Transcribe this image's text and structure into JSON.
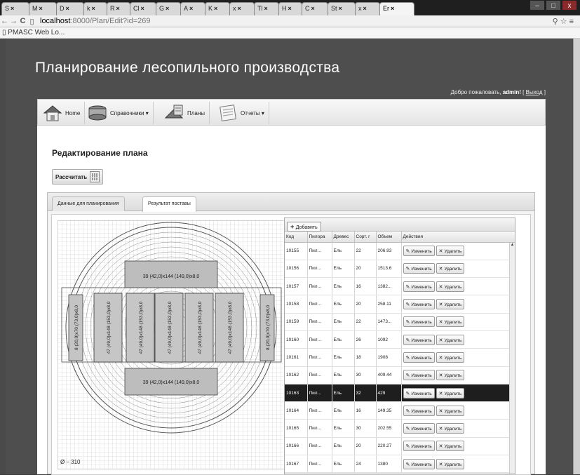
{
  "browser": {
    "tabs": [
      {
        "label": "S"
      },
      {
        "label": "M"
      },
      {
        "label": "D"
      },
      {
        "label": "k"
      },
      {
        "label": "R"
      },
      {
        "label": "Cl"
      },
      {
        "label": "G"
      },
      {
        "label": "A"
      },
      {
        "label": "K"
      },
      {
        "label": "x"
      },
      {
        "label": "Tl"
      },
      {
        "label": "H"
      },
      {
        "label": "C"
      },
      {
        "label": "St"
      },
      {
        "label": "x"
      },
      {
        "label": "Er",
        "active": true
      }
    ],
    "back": "←",
    "forward": "→",
    "reload": "C",
    "url_host": "localhost",
    "url_path": ":8000/Plan/Edit?id=269",
    "bookmark": "PMASC Web Lo..."
  },
  "site": {
    "title": "Планирование лесопильного производства",
    "welcome_prefix": "Добро пожаловать,",
    "user": "admin!",
    "logout": "Выход"
  },
  "menu": {
    "items": [
      {
        "label": "Home",
        "icon": "home-icon"
      },
      {
        "label": "Справочники ▾",
        "icon": "database-icon"
      },
      {
        "label": "Планы",
        "icon": "plans-icon"
      },
      {
        "label": "Отчеты ▾",
        "icon": "reports-icon"
      }
    ]
  },
  "page": {
    "heading": "Редактирование плана",
    "calc_button": "Рассчитать"
  },
  "panel_tabs": {
    "tab1": "Данные для планирования",
    "tab2": "Результат поставы"
  },
  "drawing": {
    "top_label": "39 (42,0)х144 (149,0)х8,0",
    "bottom_label": "39 (42,0)х144 (149,0)х8,0",
    "left_label": "8 (20,0)х70 (73,0)х8,0",
    "right_label": "8 (20,0)х70 (73,0)х8,0",
    "center_labels": [
      "47 (49,0)х148 (153,0)х8,0",
      "47 (49,0)х148 (153,0)х8,0",
      "47 (49,0)х148 (153,0)х8,0",
      "47 (49,0)х148 (153,0)х8,0",
      "47 (49,0)х148 (153,0)х8,0"
    ],
    "diameter": "Ø – 310"
  },
  "grid": {
    "add_label": "Добавить",
    "columns": [
      "Код",
      "Пилора",
      "Древес",
      "Сорт. г",
      "Объем",
      "Действия"
    ],
    "edit_label": "Изменить",
    "delete_label": "Удалить",
    "rows": [
      {
        "code": "10155",
        "saw": "Пил...",
        "wood": "Ель",
        "sort": "22",
        "volume": "206.93"
      },
      {
        "code": "10156",
        "saw": "Пил...",
        "wood": "Ель",
        "sort": "20",
        "volume": "1513.6"
      },
      {
        "code": "10157",
        "saw": "Пил...",
        "wood": "Ель",
        "sort": "16",
        "volume": "1382..."
      },
      {
        "code": "10158",
        "saw": "Пил...",
        "wood": "Ель",
        "sort": "20",
        "volume": "258.11"
      },
      {
        "code": "10159",
        "saw": "Пил...",
        "wood": "Ель",
        "sort": "22",
        "volume": "1473..."
      },
      {
        "code": "10160",
        "saw": "Пил...",
        "wood": "Ель",
        "sort": "26",
        "volume": "1092"
      },
      {
        "code": "10161",
        "saw": "Пил...",
        "wood": "Ель",
        "sort": "18",
        "volume": "1908"
      },
      {
        "code": "10162",
        "saw": "Пил...",
        "wood": "Ель",
        "sort": "30",
        "volume": "409.44"
      },
      {
        "code": "10163",
        "saw": "Пил...",
        "wood": "Ель",
        "sort": "32",
        "volume": "429",
        "selected": true
      },
      {
        "code": "10164",
        "saw": "Пил...",
        "wood": "Ель",
        "sort": "16",
        "volume": "149.35"
      },
      {
        "code": "10165",
        "saw": "Пил...",
        "wood": "Ель",
        "sort": "30",
        "volume": "202.55"
      },
      {
        "code": "10166",
        "saw": "Пил...",
        "wood": "Ель",
        "sort": "20",
        "volume": "220.27"
      },
      {
        "code": "10167",
        "saw": "Пил...",
        "wood": "Ель",
        "sort": "24",
        "volume": "1380"
      }
    ]
  }
}
